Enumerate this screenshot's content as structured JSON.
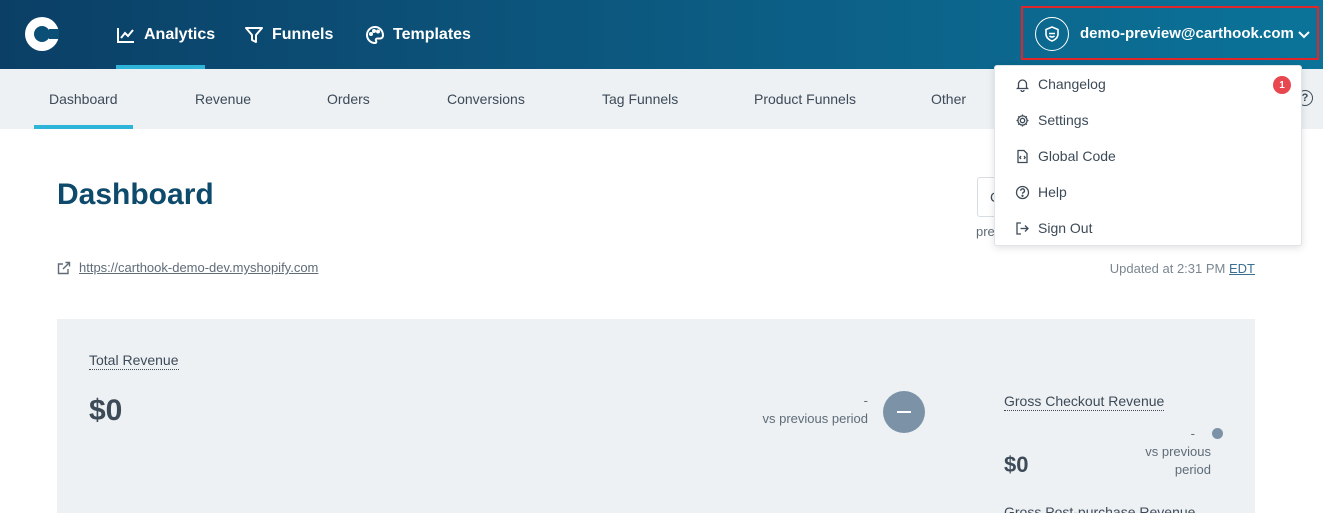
{
  "topnav": {
    "items": [
      {
        "label": "Analytics",
        "icon": "chart-line-icon"
      },
      {
        "label": "Funnels",
        "icon": "funnel-icon"
      },
      {
        "label": "Templates",
        "icon": "palette-icon"
      }
    ],
    "account_email": "demo-preview@carthook.com"
  },
  "subnav": {
    "tabs": [
      "Dashboard",
      "Revenue",
      "Orders",
      "Conversions",
      "Tag Funnels",
      "Product Funnels",
      "Other"
    ],
    "active": "Dashboard"
  },
  "main": {
    "title": "Dashboard",
    "store_url": "https://carthook-demo-dev.myshopify.com",
    "period_selector_text": "C",
    "period_caption": "pre",
    "updated_prefix": "Updated at 2:31 PM",
    "timezone": "EDT"
  },
  "card": {
    "total_revenue_label": "Total Revenue",
    "total_revenue_value": "$0",
    "total_change": "-",
    "vs_previous": "vs previous period",
    "gross_checkout_label": "Gross Checkout Revenue",
    "gross_checkout_value": "$0",
    "gross_checkout_change": "-",
    "vs_previous_line1": "vs previous",
    "vs_previous_line2": "period",
    "gross_post_purchase_label": "Gross Post-purchase Revenue"
  },
  "dropdown": {
    "items": [
      {
        "label": "Changelog",
        "icon": "bell-icon",
        "badge": "1"
      },
      {
        "label": "Settings",
        "icon": "gear-icon"
      },
      {
        "label": "Global Code",
        "icon": "code-file-icon"
      },
      {
        "label": "Help",
        "icon": "question-circle-icon"
      },
      {
        "label": "Sign Out",
        "icon": "sign-out-icon"
      }
    ]
  },
  "colors": {
    "topbar": "#0b4f77",
    "accent": "#2fb4d9",
    "title": "#0d4a6b",
    "badge": "#e8474f",
    "highlight_border": "#e0262b"
  }
}
